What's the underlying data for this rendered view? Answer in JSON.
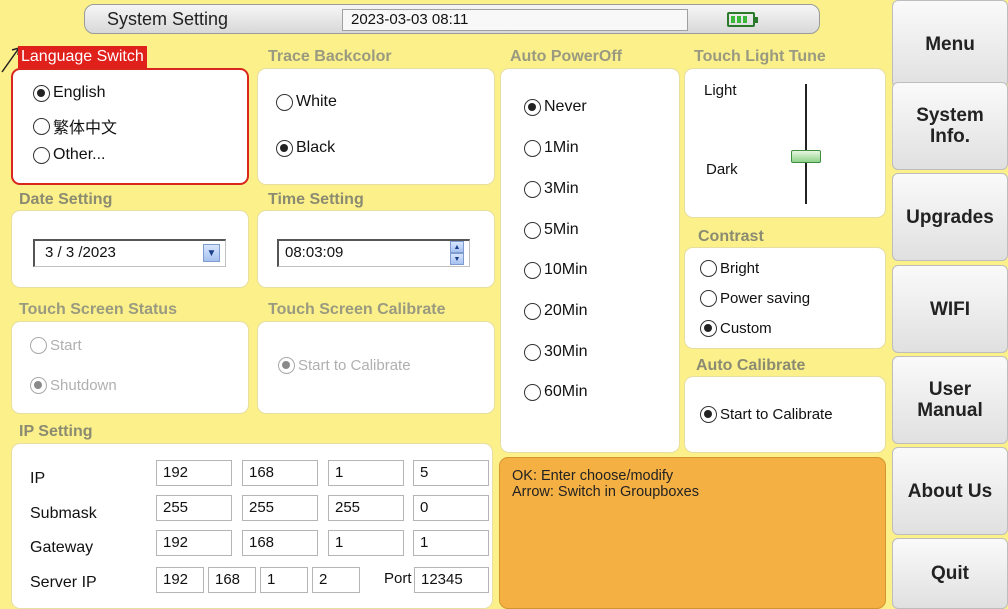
{
  "title": {
    "text": "System Setting",
    "datetime": "2023-03-03 08:11"
  },
  "language": {
    "label": "Language Switch",
    "options": [
      {
        "label": "English",
        "selected": true
      },
      {
        "label": "繁体中文",
        "selected": false
      },
      {
        "label": "Other...",
        "selected": false
      }
    ]
  },
  "trace": {
    "label": "Trace Backcolor",
    "options": [
      {
        "label": "White",
        "selected": false
      },
      {
        "label": "Black",
        "selected": true
      }
    ]
  },
  "autopower": {
    "label": "Auto PowerOff",
    "options": [
      {
        "label": "Never",
        "selected": true
      },
      {
        "label": "1Min",
        "selected": false
      },
      {
        "label": "3Min",
        "selected": false
      },
      {
        "label": "5Min",
        "selected": false
      },
      {
        "label": "10Min",
        "selected": false
      },
      {
        "label": "20Min",
        "selected": false
      },
      {
        "label": "30Min",
        "selected": false
      },
      {
        "label": "60Min",
        "selected": false
      }
    ]
  },
  "touchlight": {
    "label": "Touch Light Tune",
    "light": "Light",
    "dark": "Dark"
  },
  "date": {
    "label": "Date Setting",
    "value": "3 / 3 /2023"
  },
  "time": {
    "label": "Time Setting",
    "value": "08:03:09"
  },
  "contrast": {
    "label": "Contrast",
    "options": [
      {
        "label": "Bright",
        "selected": false
      },
      {
        "label": "Power saving",
        "selected": false
      },
      {
        "label": "Custom",
        "selected": true
      }
    ]
  },
  "touchstatus": {
    "label": "Touch Screen Status",
    "options": [
      {
        "label": "Start",
        "selected": false
      },
      {
        "label": "Shutdown",
        "selected": true
      }
    ]
  },
  "calibrate": {
    "label": "Touch Screen Calibrate",
    "button": "Start to Calibrate"
  },
  "autocal": {
    "label": "Auto Calibrate",
    "button": "Start to Calibrate"
  },
  "ip": {
    "label": "IP Setting",
    "rows": [
      {
        "label": "IP",
        "values": [
          "192",
          "168",
          "1",
          "5"
        ]
      },
      {
        "label": "Submask",
        "values": [
          "255",
          "255",
          "255",
          "0"
        ]
      },
      {
        "label": "Gateway",
        "values": [
          "192",
          "168",
          "1",
          "1"
        ]
      }
    ],
    "server": {
      "label": "Server IP",
      "values": [
        "192",
        "168",
        "1",
        "2"
      ],
      "port_label": "Port",
      "port": "12345"
    }
  },
  "hint": {
    "line1": "OK: Enter choose/modify",
    "line2": "Arrow: Switch in Groupboxes"
  },
  "sidebar": {
    "menu": "Menu",
    "system_info_1": "System",
    "system_info_2": "Info.",
    "upgrades": "Upgrades",
    "wifi": "WIFI",
    "user_manual_1": "User",
    "user_manual_2": "Manual",
    "about": "About Us",
    "quit": "Quit"
  },
  "colors": {
    "background": "#fbf08a",
    "active_border": "#d9261f",
    "hint_bg": "#f5b043"
  }
}
